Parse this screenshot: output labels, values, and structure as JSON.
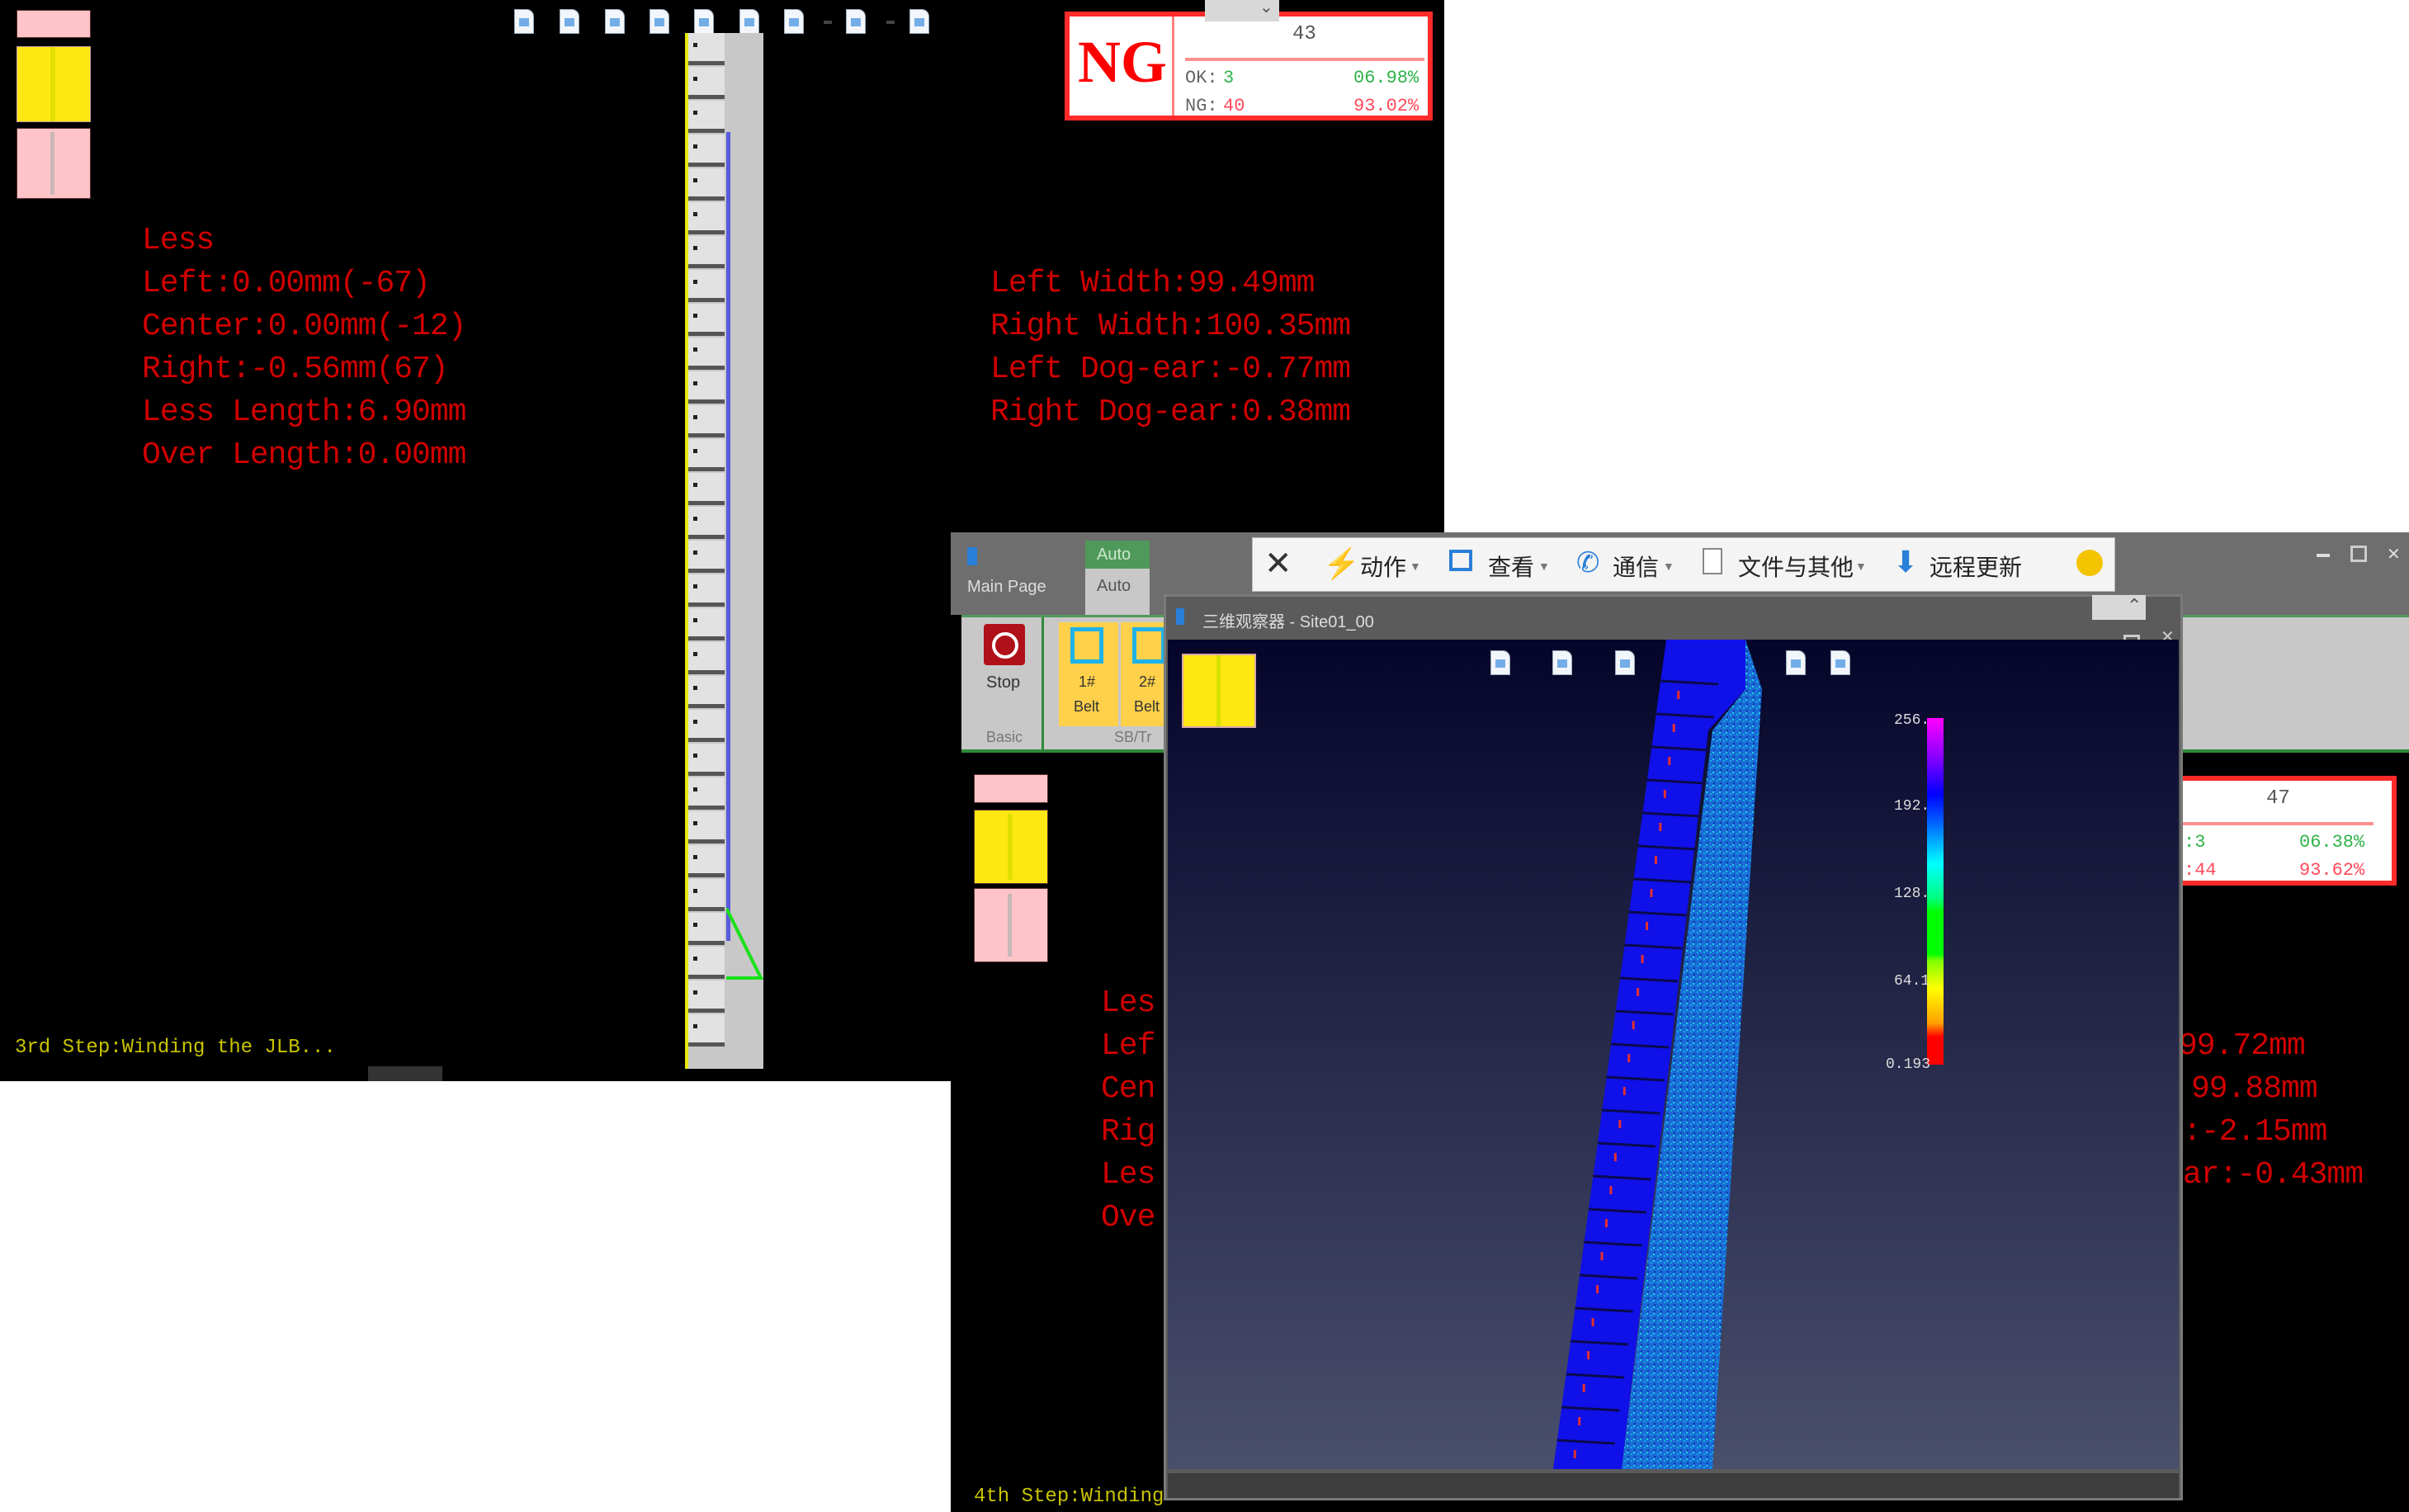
{
  "window1": {
    "toolbar_icons": [
      "fit-view-icon",
      "reset-view-icon",
      "side-view-icon",
      "save-view-icon",
      "grid-view-icon",
      "layer-icon",
      "export-icon",
      "color-map-icon",
      "image-icon"
    ],
    "less_label": "Less",
    "left_measure": "Left:0.00mm(-67)",
    "center_measure": "Center:0.00mm(-12)",
    "right_measure": "Right:-0.56mm(67)",
    "less_length": "Less Length:6.90mm",
    "over_length": "Over Length:0.00mm",
    "left_width": "Left Width:99.49mm",
    "right_width": "Right Width:100.35mm",
    "left_dog_ear": "Left Dog-ear:-0.77mm",
    "right_dog_ear": "Right Dog-ear:0.38mm",
    "status_step": "3rd Step:Winding the JLB...",
    "result": {
      "verdict": "NG",
      "total": "43",
      "ok_label": "OK:",
      "ok_count": "3",
      "ok_percent": "06.98%",
      "ng_label": "NG:",
      "ng_count": "40",
      "ng_percent": "93.02%"
    }
  },
  "window2": {
    "tabs": {
      "main_page": "Main Page",
      "auto_top": "Auto",
      "auto": "Auto"
    },
    "ribbon": {
      "stop_label": "Stop",
      "belt1_label": "1#",
      "belt1_sub": "Belt",
      "belt2_label": "2#",
      "belt2_sub": "Belt",
      "group_basic": "Basic",
      "group_sb": "SB/Tr"
    },
    "toolbar": {
      "action": "动作",
      "view": "查看",
      "comm": "通信",
      "files": "文件与其他",
      "remote_update": "远程更新"
    },
    "viewer": {
      "title": "三维观察器 - Site01_00",
      "colorbar": {
        "max": "256.",
        "t2": "192.",
        "t3": "128.",
        "t4": "64.1",
        "min": "0.193"
      }
    },
    "partial_text": {
      "less": "Les",
      "left": "Lef",
      "center": "Cen",
      "right": "Rig",
      "less_len": "Les",
      "over": "Ove",
      "left_width": "99.72mm",
      "right_width": "99.88mm",
      "left_dog": ":-2.15mm",
      "right_dog": "ar:-0.43mm"
    },
    "status_step": "4th Step:Winding",
    "result": {
      "total": "47",
      "ok_count": ":3",
      "ok_percent": "06.38%",
      "ng_count": ":44",
      "ng_percent": "93.62%"
    }
  }
}
